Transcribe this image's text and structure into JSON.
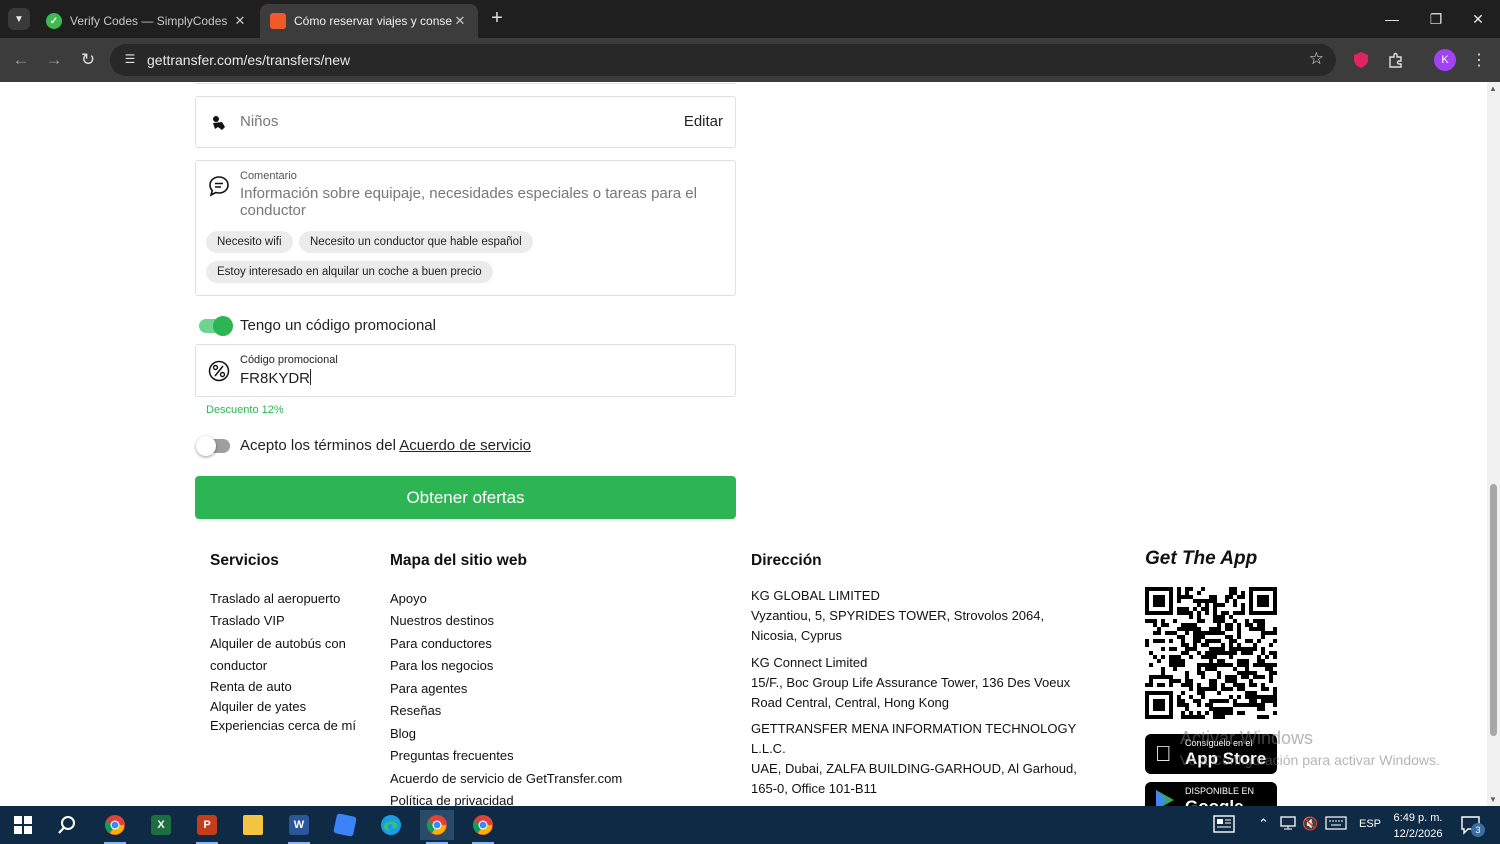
{
  "browser": {
    "tabs": [
      {
        "title": "Verify Codes — SimplyCodes",
        "active": false
      },
      {
        "title": "Cómo reservar viajes y consegu",
        "active": true
      }
    ],
    "url": "gettransfer.com/es/transfers/new",
    "profile_initial": "K",
    "icons": {
      "tab_list": "chevron-down-icon",
      "close": "close-icon",
      "new_tab": "plus-icon",
      "back": "arrow-left-icon",
      "forward": "arrow-right-icon",
      "reload": "reload-icon",
      "site_info": "tune-icon",
      "bookmark": "star-icon",
      "extension": "puzzle-icon",
      "menu": "kebab-icon"
    }
  },
  "form": {
    "children": {
      "label": "Niños",
      "action": "Editar"
    },
    "comment": {
      "label": "Comentario",
      "placeholder": "Información sobre equipaje, necesidades especiales o tareas para el conductor",
      "chips": [
        "Necesito wifi",
        "Necesito un conductor que hable español",
        "Estoy interesado en alquilar un coche a buen precio"
      ]
    },
    "promo_toggle": {
      "label": "Tengo un código promocional",
      "on": true
    },
    "promo": {
      "label": "Código promocional",
      "value": "FR8KYDR",
      "discount": "Descuento 12%"
    },
    "terms": {
      "text": "Acepto los términos del ",
      "link": "Acuerdo de servicio",
      "on": false
    },
    "submit": "Obtener ofertas"
  },
  "footer": {
    "services": {
      "title": "Servicios",
      "links": [
        "Traslado al aeropuerto",
        "Traslado VIP",
        "Alquiler de autobús con",
        "conductor",
        "Renta de auto",
        "Alquiler de yates",
        "Experiencias cerca de mí"
      ]
    },
    "sitemap": {
      "title": "Mapa del sitio web",
      "links": [
        "Apoyo",
        "Nuestros destinos",
        "Para conductores",
        "Para los negocios",
        "Para agentes",
        "Reseñas",
        "Blog",
        "Preguntas frecuentes",
        "Acuerdo de servicio de GetTransfer.com",
        "Política de privacidad"
      ]
    },
    "address": {
      "title": "Dirección",
      "blocks": [
        [
          "KG GLOBAL LIMITED",
          "Vyzantiou, 5, SPYRIDES TOWER, Strovolos 2064,",
          "Nicosia, Cyprus"
        ],
        [
          "KG Connect Limited",
          "15/F., Boc Group Life Assurance Tower, 136 Des Voeux",
          "Road Central, Central, Hong Kong"
        ],
        [
          "GETTRANSFER MENA INFORMATION TECHNOLOGY",
          "L.L.C.",
          "UAE, Dubai, ZALFA BUILDING-GARHOUD, Al Garhoud,",
          "165-0, Office 101-B11"
        ]
      ]
    },
    "app": {
      "title": "Get The App",
      "appstore": {
        "small": "Consíguelo en el",
        "big": "App Store"
      },
      "googleplay": {
        "small": "DISPONIBLE EN",
        "big": "Google Play"
      }
    }
  },
  "watermark": {
    "line1": "Activar Windows",
    "line2": "Ve a Configuración para activar Windows."
  },
  "taskbar": {
    "apps": [
      "start-icon",
      "search-icon",
      "chrome-icon",
      "excel-icon",
      "powerpoint-icon",
      "file-explorer-icon",
      "word-icon",
      "roblox-icon",
      "edge-icon",
      "chrome-icon",
      "chrome-icon"
    ],
    "language": "ESP",
    "time": "6:49 p. m.",
    "date": "12/2/2026",
    "notifications": "3"
  },
  "colors": {
    "accent": "#2db553",
    "chrome_dark": "#1f1f1f",
    "taskbar": "#0f2a44"
  }
}
